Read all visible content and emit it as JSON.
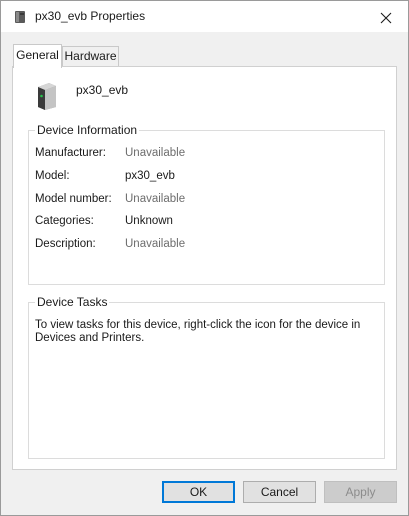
{
  "window": {
    "title": "px30_evb Properties",
    "close_glyph": "✕"
  },
  "tabs": [
    {
      "label": "General",
      "active": true
    },
    {
      "label": "Hardware",
      "active": false
    }
  ],
  "device": {
    "name": "px30_evb",
    "icon": "printer-device-icon"
  },
  "device_info": {
    "title": "Device Information",
    "rows": [
      {
        "label": "Manufacturer:",
        "value": "Unavailable",
        "muted": true
      },
      {
        "label": "Model:",
        "value": "px30_evb",
        "muted": false
      },
      {
        "label": "Model number:",
        "value": "Unavailable",
        "muted": true
      },
      {
        "label": "Categories:",
        "value": "Unknown",
        "muted": false
      },
      {
        "label": "Description:",
        "value": "Unavailable",
        "muted": true
      }
    ]
  },
  "device_tasks": {
    "title": "Device Tasks",
    "text": "To view tasks for this device, right-click the icon for the device in Devices and Printers."
  },
  "buttons": {
    "ok": "OK",
    "cancel": "Cancel",
    "apply": "Apply"
  },
  "colors": {
    "accent": "#0078d7",
    "muted_text": "#6d6d6d",
    "window_bg": "#f0f0f0"
  }
}
